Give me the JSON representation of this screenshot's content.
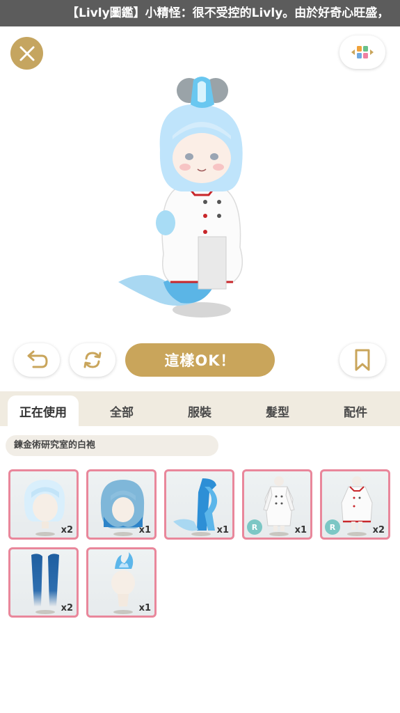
{
  "ticker": {
    "text": "【Livly圖鑑】小精怪：很不受控的Livly。由於好奇心旺盛，"
  },
  "icons": {
    "close": "close-icon",
    "layout": "layout-grid-icon",
    "undo": "undo-icon",
    "refresh": "refresh-icon",
    "bookmark": "bookmark-icon"
  },
  "actions": {
    "ok_label": "這樣OK！"
  },
  "tabs": [
    {
      "label": "正在使用"
    },
    {
      "label": "全部"
    },
    {
      "label": "服裝"
    },
    {
      "label": "髮型"
    },
    {
      "label": "配件"
    }
  ],
  "filter": {
    "label": "鍊金術研究室的白袍"
  },
  "items": [
    {
      "icon": "white-hair-icon",
      "qty": "x2"
    },
    {
      "icon": "blue-hair-icon",
      "qty": "x1"
    },
    {
      "icon": "mermaid-tail-icon",
      "qty": "x1"
    },
    {
      "icon": "white-lab-coat-icon",
      "qty": "x1",
      "badge": "R"
    },
    {
      "icon": "white-coat-red-trim-icon",
      "qty": "x2",
      "badge": "R"
    },
    {
      "icon": "blue-legs-icon",
      "qty": "x2"
    },
    {
      "icon": "blue-flame-ornament-icon",
      "qty": "x1"
    }
  ],
  "colors": {
    "accent": "#c9a55b",
    "item_border": "#e9879b",
    "tab_bar": "#f0ebe0"
  }
}
